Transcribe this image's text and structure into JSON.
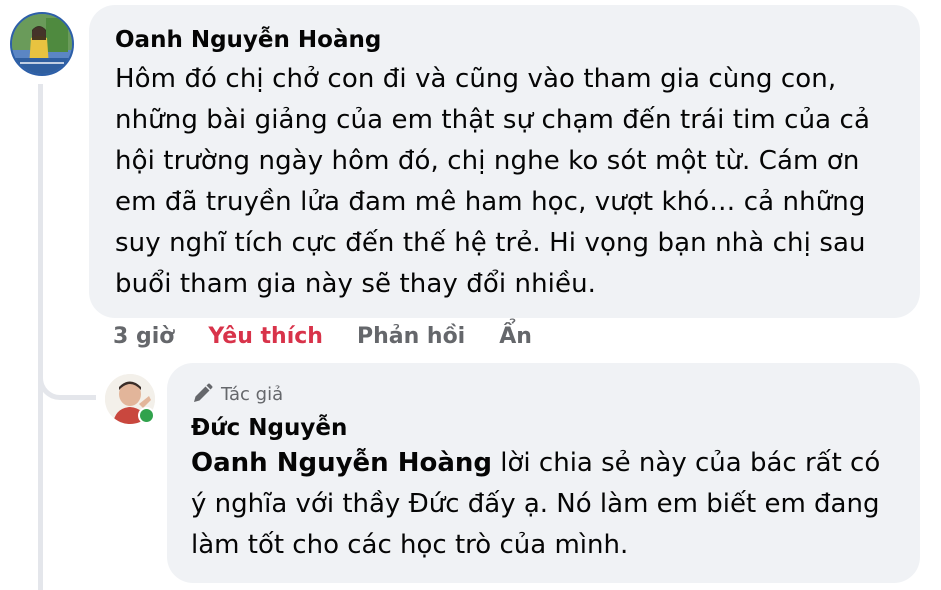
{
  "comment": {
    "author": "Oanh Nguyễn Hoàng",
    "text": "Hôm đó chị chở con đi và cũng vào tham gia cùng con, những bài giảng của em thật sự chạm đến trái tim của cả hội trường ngày hôm đó, chị nghe ko sót một từ. Cám ơn em đã truyền lửa đam mê ham học, vượt khó… cả những suy nghĩ tích cực đến thế hệ trẻ. Hi vọng bạn nhà chị sau buổi tham gia này sẽ thay đổi nhiều.",
    "time": "3 giờ",
    "like_label": "Yêu thích",
    "reply_label": "Phản hồi",
    "hide_label": "Ẩn"
  },
  "reply": {
    "badge": "Tác giả",
    "author": "Đức Nguyễn",
    "mention": "Oanh Nguyễn Hoàng",
    "text": " lời chia sẻ này của bác rất có ý nghĩa với thầy Đức đấy ạ. Nó làm em biết em đang làm tốt cho các học trò của mình."
  },
  "colors": {
    "bubble": "#f0f2f5",
    "like_active": "#d8334a",
    "secondary_text": "#65676b",
    "online": "#31a24c"
  },
  "icons": {
    "author_badge": "pencil-icon"
  }
}
